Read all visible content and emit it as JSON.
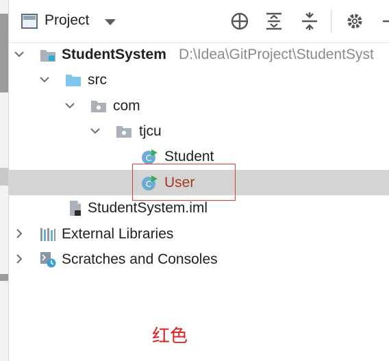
{
  "toolbar": {
    "title": "Project",
    "icons": [
      "project-window-icon",
      "chevron-down-icon",
      "locate-icon",
      "expand-all-icon",
      "collapse-all-icon",
      "gear-icon",
      "hide-icon"
    ]
  },
  "tree": {
    "root": {
      "label": "StudentSystem",
      "path": "D:\\Idea\\GitProject\\StudentSyst"
    },
    "src": "src",
    "com": "com",
    "tjcu": "tjcu",
    "student": "Student",
    "user": "User",
    "iml": "StudentSystem.iml",
    "external_libraries": "External Libraries",
    "scratches": "Scratches and Consoles"
  },
  "annotation": "红色",
  "colors": {
    "selection_bg": "#d4d4d4",
    "highlight_border": "#e03b3b",
    "annotation_text": "#e31b1b",
    "user_label": "#a33a1e",
    "folder_blue": "#7fc6ea",
    "package_gray": "#a9b2bb",
    "class_circle": "#6aaed6",
    "run_green": "#3cab5d"
  }
}
